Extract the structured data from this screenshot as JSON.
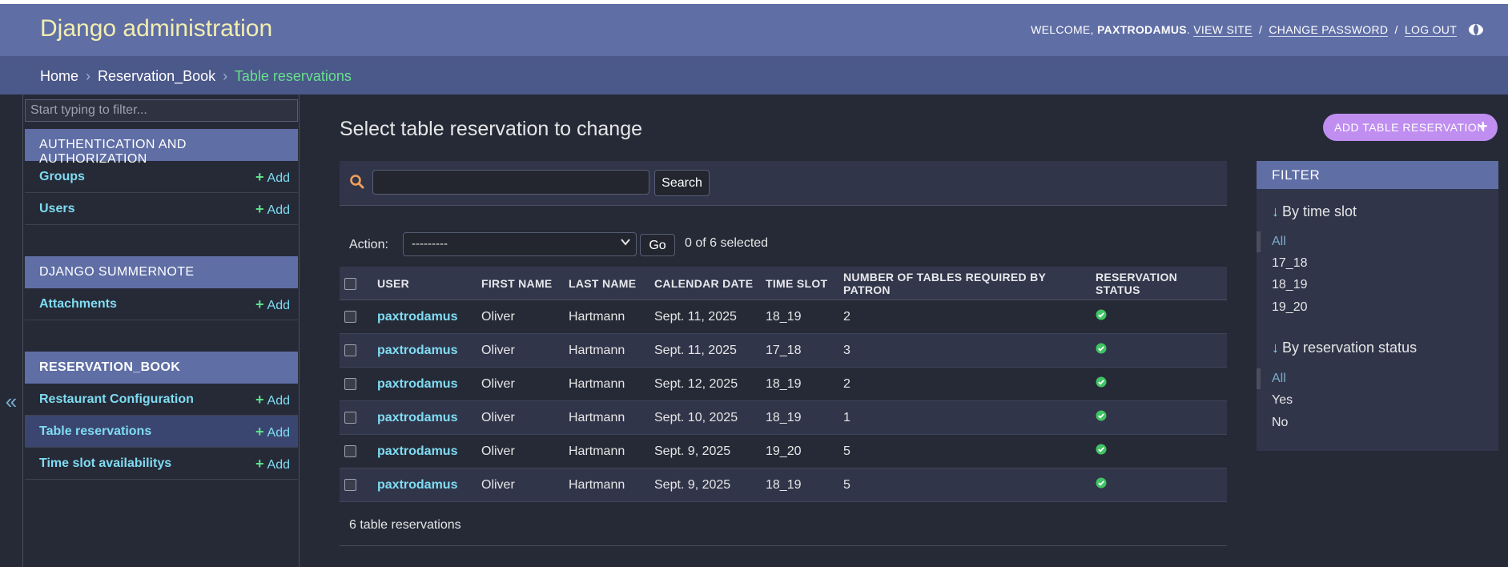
{
  "header": {
    "branding": "Django administration",
    "welcome": "WELCOME,",
    "username": "PAXTRODAMUS",
    "view_site": "VIEW SITE",
    "change_password": "CHANGE PASSWORD",
    "log_out": "LOG OUT",
    "separator": "/"
  },
  "breadcrumbs": {
    "home": "Home",
    "app": "Reservation_Book",
    "current": "Table reservations",
    "arrow": "›"
  },
  "nav": {
    "toggle_glyph": "«",
    "filter_placeholder": "Start typing to filter...",
    "add_label": "Add",
    "modules": [
      {
        "caption": "AUTHENTICATION AND AUTHORIZATION",
        "models": [
          "Groups",
          "Users"
        ]
      },
      {
        "caption": "DJANGO SUMMERNOTE",
        "models": [
          "Attachments"
        ]
      },
      {
        "caption": "RESERVATION_BOOK",
        "models": [
          "Restaurant Configuration",
          "Table reservations",
          "Time slot availabilitys"
        ]
      }
    ]
  },
  "content": {
    "title": "Select table reservation to change",
    "add_button": "ADD TABLE RESERVATION",
    "search_button": "Search",
    "action_label": "Action:",
    "action_value": "---------",
    "go_button": "Go",
    "selected_count": "0 of 6 selected",
    "paginator": "6 table reservations"
  },
  "table": {
    "headers": [
      "USER",
      "FIRST NAME",
      "LAST NAME",
      "CALENDAR DATE",
      "TIME SLOT",
      "NUMBER OF TABLES REQUIRED BY PATRON",
      "RESERVATION STATUS"
    ],
    "rows": [
      {
        "user": "paxtrodamus",
        "first": "Oliver",
        "last": "Hartmann",
        "date": "Sept. 11, 2025",
        "slot": "18_19",
        "tables": "2",
        "status": true
      },
      {
        "user": "paxtrodamus",
        "first": "Oliver",
        "last": "Hartmann",
        "date": "Sept. 11, 2025",
        "slot": "17_18",
        "tables": "3",
        "status": true
      },
      {
        "user": "paxtrodamus",
        "first": "Oliver",
        "last": "Hartmann",
        "date": "Sept. 12, 2025",
        "slot": "18_19",
        "tables": "2",
        "status": true
      },
      {
        "user": "paxtrodamus",
        "first": "Oliver",
        "last": "Hartmann",
        "date": "Sept. 10, 2025",
        "slot": "18_19",
        "tables": "1",
        "status": true
      },
      {
        "user": "paxtrodamus",
        "first": "Oliver",
        "last": "Hartmann",
        "date": "Sept. 9, 2025",
        "slot": "19_20",
        "tables": "5",
        "status": true
      },
      {
        "user": "paxtrodamus",
        "first": "Oliver",
        "last": "Hartmann",
        "date": "Sept. 9, 2025",
        "slot": "18_19",
        "tables": "5",
        "status": true
      }
    ]
  },
  "filter": {
    "title": "FILTER",
    "arrow": "↓",
    "by_time_slot": "By time slot",
    "time_slot_options": [
      "All",
      "17_18",
      "18_19",
      "19_20"
    ],
    "by_status": "By reservation status",
    "status_options": [
      "All",
      "Yes",
      "No"
    ]
  },
  "colors": {
    "header_bg": "#5f6ea5",
    "body_bg": "#262a37",
    "link": "#7fdcf2",
    "add_plus": "#5ee08a",
    "add_button": "#bf8ef0",
    "status_ok": "#40c463"
  },
  "icons": [
    "moon-icon",
    "search-icon",
    "plus-icon",
    "checkmark-circle-icon",
    "chevron-down-icon",
    "collapse-arrow-icon"
  ]
}
